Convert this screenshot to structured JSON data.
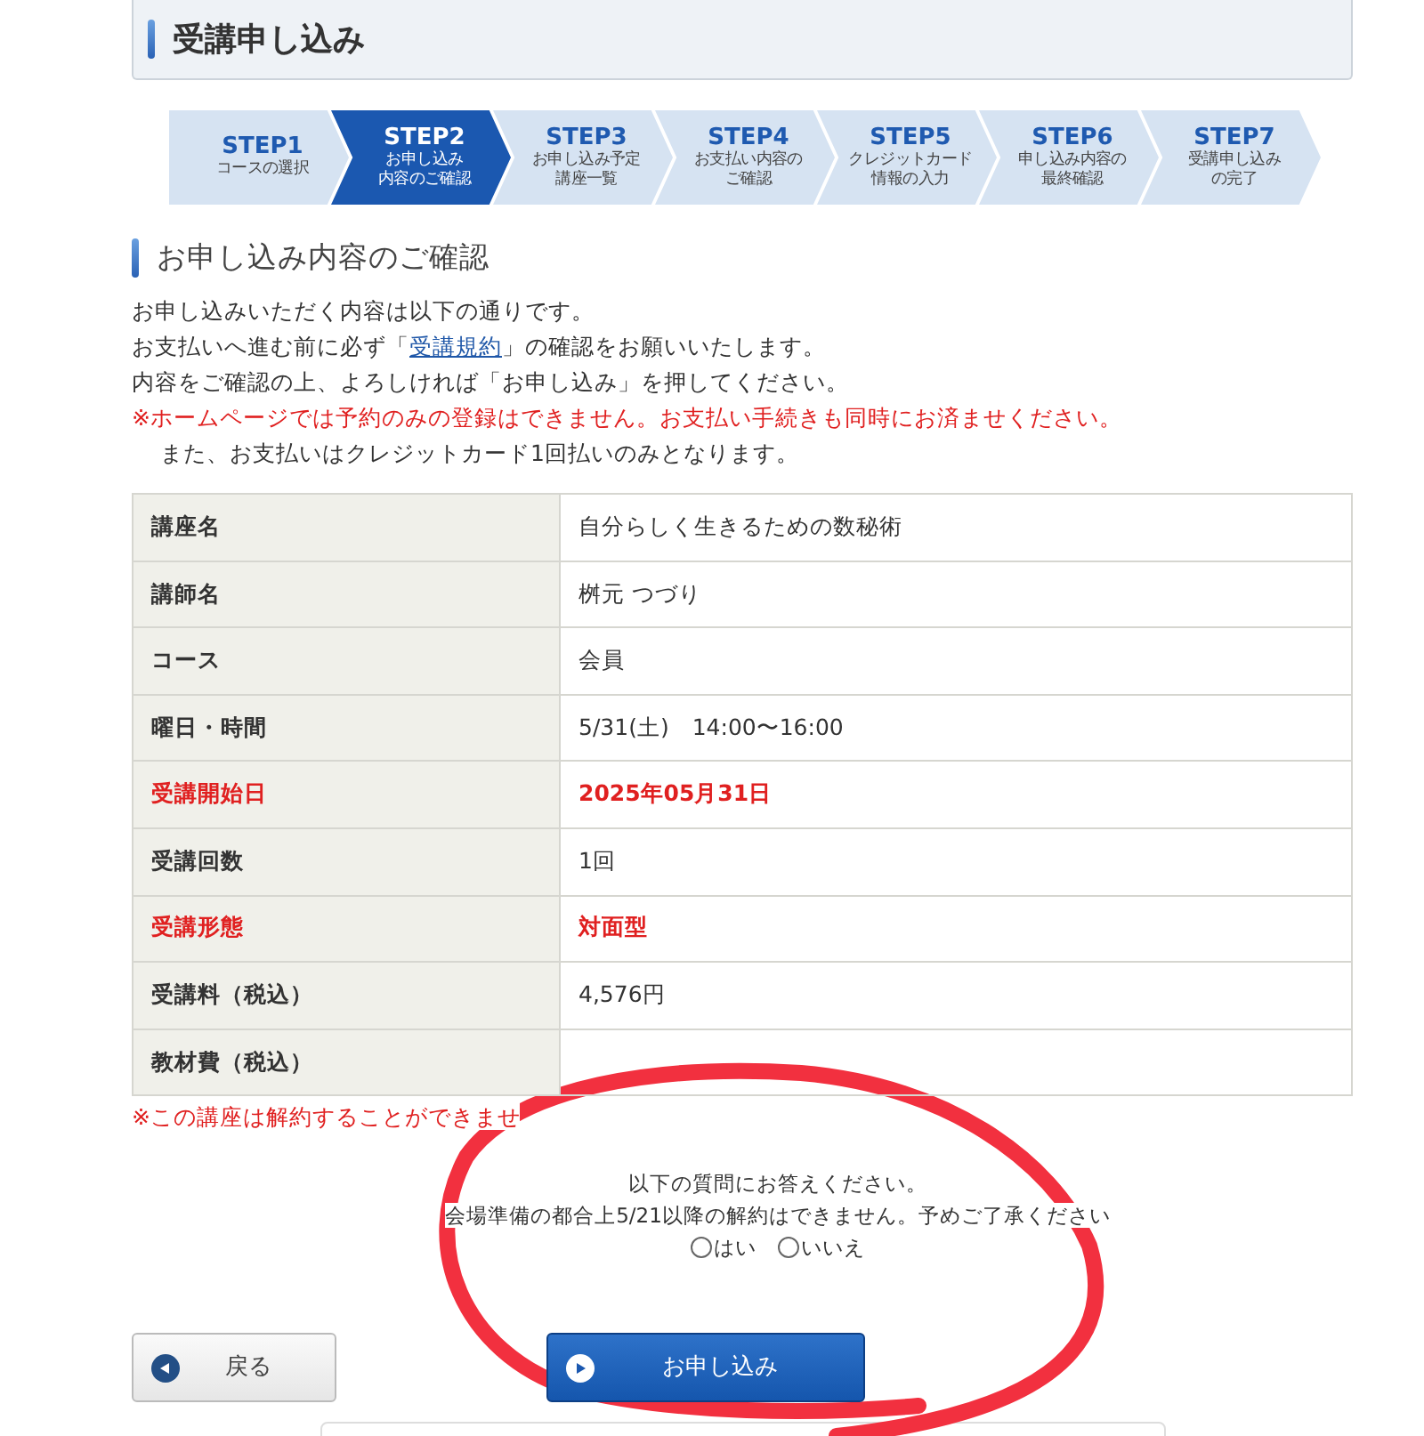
{
  "page_title": "受講申し込み",
  "steps": [
    {
      "label": "STEP1",
      "caption_lines": [
        "コースの選択"
      ],
      "selected": false
    },
    {
      "label": "STEP2",
      "caption_lines": [
        "お申し込み",
        "内容のご確認"
      ],
      "selected": true
    },
    {
      "label": "STEP3",
      "caption_lines": [
        "お申し込み予定",
        "講座一覧"
      ],
      "selected": false
    },
    {
      "label": "STEP4",
      "caption_lines": [
        "お支払い内容の",
        "ご確認"
      ],
      "selected": false
    },
    {
      "label": "STEP5",
      "caption_lines": [
        "クレジットカード",
        "情報の入力"
      ],
      "selected": false
    },
    {
      "label": "STEP6",
      "caption_lines": [
        "申し込み内容の",
        "最終確認"
      ],
      "selected": false
    },
    {
      "label": "STEP7",
      "caption_lines": [
        "受講申し込み",
        "の完了"
      ],
      "selected": false
    }
  ],
  "section_title": "お申し込み内容のご確認",
  "intro": [
    {
      "kind": "plain",
      "parts": [
        {
          "text": "お申し込みいただく内容は以下の通りです。"
        }
      ]
    },
    {
      "kind": "plain",
      "parts": [
        {
          "text": "お支払いへ進む前に必ず「"
        },
        {
          "text": "受講規約",
          "link": true
        },
        {
          "text": "」の確認をお願いいたします。"
        }
      ]
    },
    {
      "kind": "plain",
      "parts": [
        {
          "text": "内容をご確認の上、よろしければ「お申し込み」を押してください。"
        }
      ]
    },
    {
      "kind": "warning",
      "parts": [
        {
          "text": "※ホームページでは予約のみの登録はできません。お支払い手続きも同時にお済ませください。"
        }
      ]
    },
    {
      "kind": "indent",
      "parts": [
        {
          "text": "また、お支払いはクレジットカード1回払いのみとなります。"
        }
      ]
    }
  ],
  "details": [
    {
      "label": "講座名",
      "value": "自分らしく生きるための数秘術",
      "emphasis": false
    },
    {
      "label": "講師名",
      "value": "桝元 つづり",
      "emphasis": false
    },
    {
      "label": "コース",
      "value": "会員",
      "emphasis": false
    },
    {
      "label": "曜日・時間",
      "value": "5/31(土)　14:00〜16:00",
      "emphasis": false
    },
    {
      "label": "受講開始日",
      "value": "2025年05月31日",
      "emphasis": true
    },
    {
      "label": "受講回数",
      "value": "1回",
      "emphasis": false
    },
    {
      "label": "受講形態",
      "value": "対面型",
      "emphasis": true
    },
    {
      "label": "受講料（税込）",
      "value": "4,576円",
      "emphasis": false
    },
    {
      "label": "教材費（税込）",
      "emphasis": false
    }
  ],
  "cancel_note": "※この講座は解約することができませ",
  "question": {
    "prompt": "以下の質問にお答えください。",
    "text": "会場準備の都合上5/21以降の解約はできません。予めご了承ください",
    "options": [
      {
        "label": "はい",
        "selected": false
      },
      {
        "label": "いいえ",
        "selected": false
      }
    ]
  },
  "buttons": [
    {
      "kind": "back",
      "label": "戻る"
    },
    {
      "kind": "primary",
      "label": "お申し込み"
    }
  ]
}
